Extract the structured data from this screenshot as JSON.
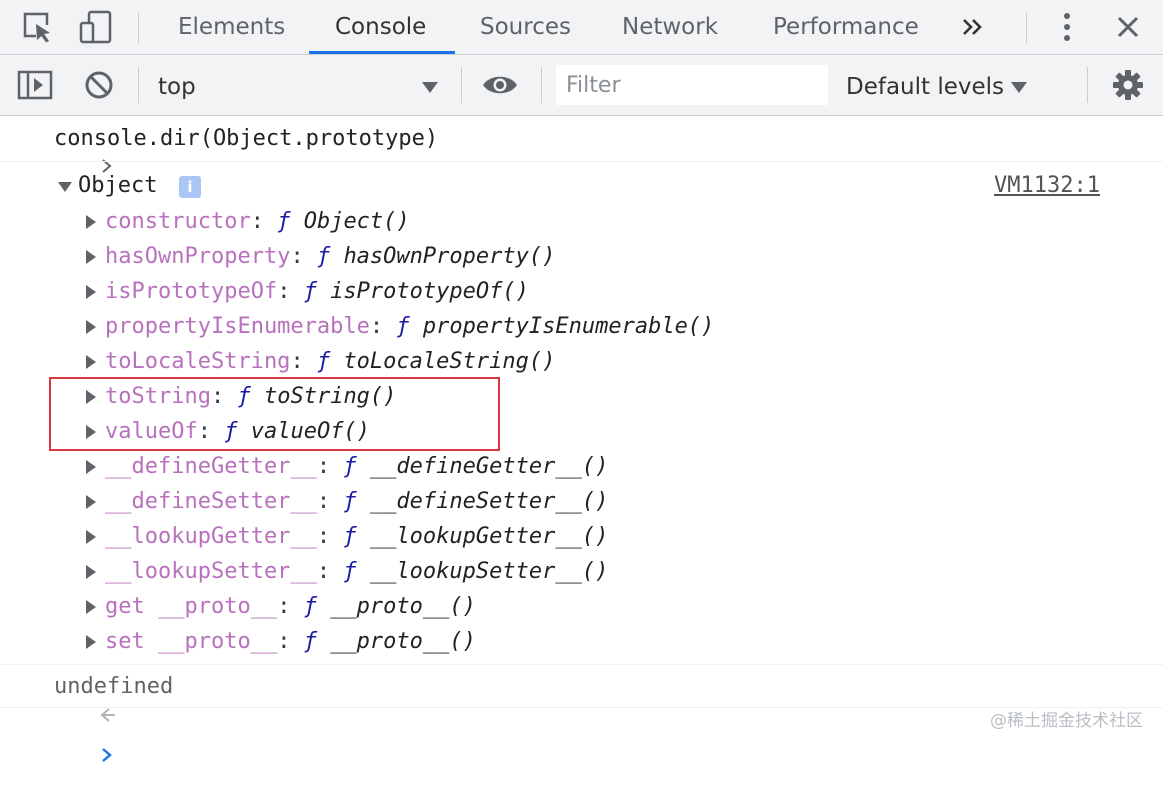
{
  "tabs": [
    {
      "label": "Elements"
    },
    {
      "label": "Console"
    },
    {
      "label": "Sources"
    },
    {
      "label": "Network"
    },
    {
      "label": "Performance"
    }
  ],
  "toolbar": {
    "context": "top",
    "filter_placeholder": "Filter",
    "levels": "Default levels"
  },
  "console": {
    "command": "console.dir(Object.prototype)",
    "object_label": "Object",
    "info_badge": "i",
    "source_link": "VM1132:1",
    "properties": [
      {
        "name": "constructor",
        "func": "Object()"
      },
      {
        "name": "hasOwnProperty",
        "func": "hasOwnProperty()"
      },
      {
        "name": "isPrototypeOf",
        "func": "isPrototypeOf()"
      },
      {
        "name": "propertyIsEnumerable",
        "func": "propertyIsEnumerable()"
      },
      {
        "name": "toLocaleString",
        "func": "toLocaleString()"
      },
      {
        "name": "toString",
        "func": "toString()"
      },
      {
        "name": "valueOf",
        "func": "valueOf()"
      },
      {
        "name": "__defineGetter__",
        "func": "__defineGetter__()"
      },
      {
        "name": "__defineSetter__",
        "func": "__defineSetter__()"
      },
      {
        "name": "__lookupGetter__",
        "func": "__lookupGetter__()"
      },
      {
        "name": "__lookupSetter__",
        "func": "__lookupSetter__()"
      },
      {
        "name": "get __proto__",
        "func": "__proto__()"
      },
      {
        "name": "set __proto__",
        "func": "__proto__()"
      }
    ],
    "function_symbol": "ƒ",
    "result": "undefined"
  },
  "watermark": "@稀土掘金技术社区",
  "colors": {
    "accent": "#1a73e8",
    "property": "#b871bd",
    "highlight_border": "#d9363e",
    "toolbar_bg": "#f1f3f4"
  }
}
